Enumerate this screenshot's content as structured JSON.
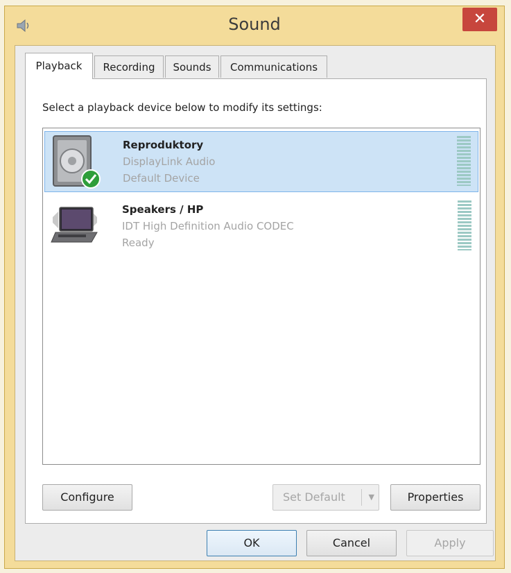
{
  "window": {
    "title": "Sound",
    "close_label": "✕"
  },
  "tabs": [
    {
      "label": "Playback",
      "active": true
    },
    {
      "label": "Recording",
      "active": false
    },
    {
      "label": "Sounds",
      "active": false
    },
    {
      "label": "Communications",
      "active": false
    }
  ],
  "playback": {
    "instruction": "Select a playback device below to modify its settings:",
    "devices": [
      {
        "name": "Reproduktory",
        "driver": "DisplayLink Audio",
        "status": "Default Device",
        "icon": "speaker-icon",
        "is_default": true,
        "selected": true
      },
      {
        "name": "Speakers / HP",
        "driver": "IDT High Definition Audio CODEC",
        "status": "Ready",
        "icon": "laptop-speakers-icon",
        "is_default": false,
        "selected": false
      }
    ]
  },
  "buttons": {
    "configure": "Configure",
    "set_default": "Set Default",
    "properties": "Properties",
    "ok": "OK",
    "cancel": "Cancel",
    "apply": "Apply"
  },
  "colors": {
    "frame": "#f4dc9a",
    "close": "#c7463d",
    "selection": "#cde3f6",
    "default_check": "#2e9e3a"
  }
}
